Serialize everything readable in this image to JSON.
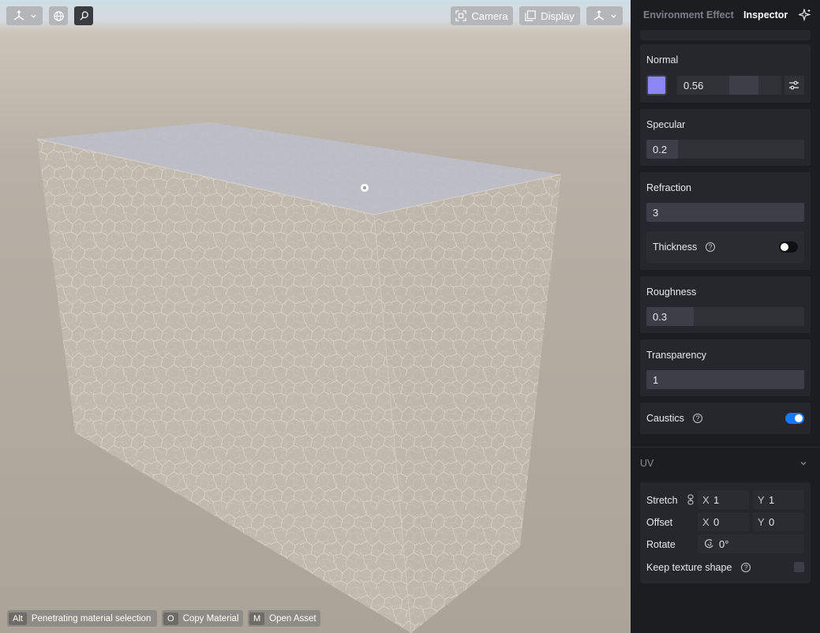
{
  "toolbar": {
    "camera_label": "Camera",
    "display_label": "Display"
  },
  "hints": [
    {
      "key": "Alt",
      "label": "Penetrating material selection"
    },
    {
      "key": "O",
      "label": "Copy Material"
    },
    {
      "key": "M",
      "label": "Open Asset"
    }
  ],
  "tabs": {
    "environment": "Environment",
    "effect": "Effect",
    "inspector": "Inspector"
  },
  "normal": {
    "title": "Normal",
    "color": "#8c86f5",
    "value": "0.56",
    "fraction": 0.56
  },
  "specular": {
    "title": "Specular",
    "value": "0.2",
    "fraction": 0.2
  },
  "refraction": {
    "title": "Refraction",
    "value": "3",
    "thickness_label": "Thickness",
    "thickness_on": false
  },
  "roughness": {
    "title": "Roughness",
    "value": "0.3",
    "fraction": 0.3
  },
  "transparency": {
    "title": "Transparency",
    "value": "1",
    "fraction": 1
  },
  "caustics": {
    "label": "Caustics",
    "on": true
  },
  "uv": {
    "title": "UV",
    "stretch": {
      "label": "Stretch",
      "x": "1",
      "y": "1"
    },
    "offset": {
      "label": "Offset",
      "x": "0",
      "y": "0"
    },
    "rotate": {
      "label": "Rotate",
      "value": "0°"
    },
    "keep_shape_label": "Keep texture shape",
    "axis_x": "X",
    "axis_y": "Y"
  },
  "colors": {
    "accent": "#1677ff",
    "panel_bg": "#1c1d21",
    "card_bg": "#25272c"
  }
}
